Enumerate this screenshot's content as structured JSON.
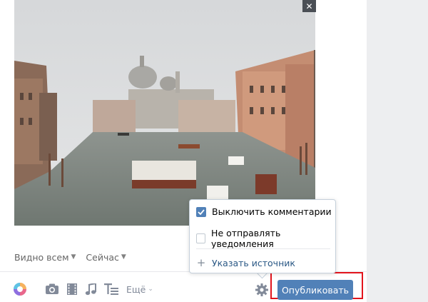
{
  "photo": {
    "alt": "photo-venice-grand-canal"
  },
  "close_icon": "close-icon",
  "meta": {
    "privacy_label": "Видно всем",
    "time_label": "Сейчас"
  },
  "toolbar": {
    "icons": [
      "paint-palette-icon",
      "camera-icon",
      "video-icon",
      "music-icon",
      "text-format-icon"
    ],
    "more_label": "Ещё",
    "settings_icon": "gear-icon",
    "publish_label": "Опубликовать"
  },
  "popup": {
    "options": [
      {
        "label": "Выключить комментарии",
        "checked": true
      },
      {
        "label": "Не отправлять уведомления",
        "checked": false
      }
    ],
    "source_label": "Указать источник"
  },
  "colors": {
    "accent": "#5181b8",
    "link": "#2a5885",
    "highlight": "#e2141d"
  }
}
